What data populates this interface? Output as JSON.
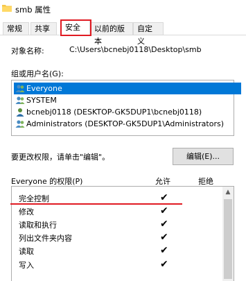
{
  "window": {
    "title": "smb 属性"
  },
  "tabs": [
    {
      "label": "常规",
      "active": false
    },
    {
      "label": "共享",
      "active": false
    },
    {
      "label": "安全",
      "active": true
    },
    {
      "label": "以前的版本",
      "active": false
    },
    {
      "label": "自定义",
      "active": false
    }
  ],
  "object": {
    "label": "对象名称:",
    "value": "C:\\Users\\bcnebj0118\\Desktop\\smb"
  },
  "groups": {
    "label": "组或用户名(G):",
    "items": [
      {
        "name": "Everyone",
        "selected": true,
        "icon": "users-group-icon"
      },
      {
        "name": "SYSTEM",
        "selected": false,
        "icon": "users-group-icon"
      },
      {
        "name": "bcnebj0118 (DESKTOP-GK5DUP1\\bcnebj0118)",
        "selected": false,
        "icon": "user-icon"
      },
      {
        "name": "Administrators (DESKTOP-GK5DUP1\\Administrators)",
        "selected": false,
        "icon": "users-group-icon"
      }
    ]
  },
  "change_hint": "要更改权限，请单击\"编辑\"。",
  "edit_button": "编辑(E)...",
  "permissions": {
    "title": "Everyone 的权限(P)",
    "allow_label": "允许",
    "deny_label": "拒绝",
    "rows": [
      {
        "name": "完全控制",
        "allow": true,
        "deny": false
      },
      {
        "name": "修改",
        "allow": true,
        "deny": false
      },
      {
        "name": "读取和执行",
        "allow": true,
        "deny": false
      },
      {
        "name": "列出文件夹内容",
        "allow": true,
        "deny": false
      },
      {
        "name": "读取",
        "allow": true,
        "deny": false
      },
      {
        "name": "写入",
        "allow": true,
        "deny": false
      }
    ],
    "check_glyph": "✔"
  },
  "colors": {
    "accent": "#e01a22",
    "selection": "#0078d7"
  }
}
